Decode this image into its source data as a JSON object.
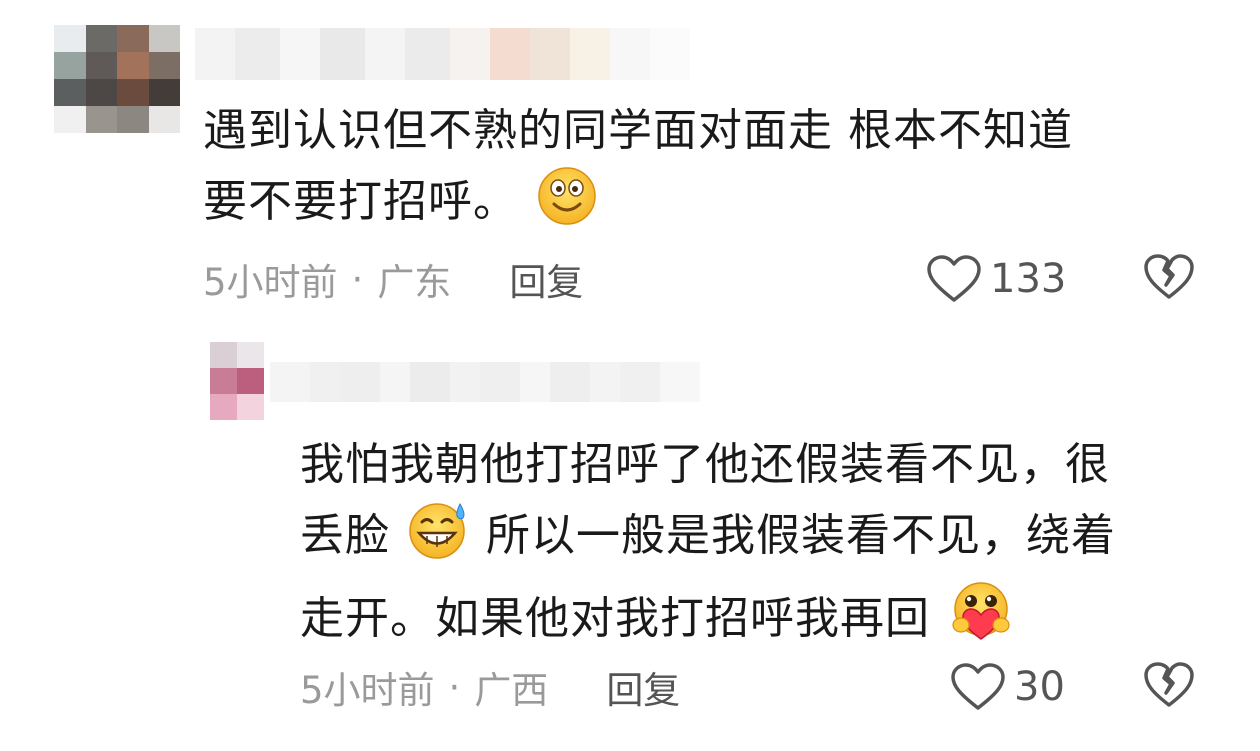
{
  "comments": [
    {
      "text_lines": [
        "遇到认识但不熟的同学面对面走 根本不知道",
        "要不要打招呼。"
      ],
      "emoji": "smile-emoji",
      "time": "5小时前",
      "location": "广东",
      "reply_label": "回复",
      "likes": "133"
    },
    {
      "text_lines": [
        "我怕我朝他打招呼了他还假装看不见，很",
        "丢脸",
        "所以一般是我假装看不见，绕着",
        "走开。如果他对我打招呼我再回"
      ],
      "emoji_mid": "sweat-grin-emoji",
      "emoji_end": "heart-hug-emoji",
      "time": "5小时前",
      "location": "广西",
      "reply_label": "回复",
      "likes": "30"
    }
  ],
  "separator": "·",
  "colors": {
    "text": "#1a1a1a",
    "meta": "#9a9a9a",
    "icon": "#555555"
  }
}
